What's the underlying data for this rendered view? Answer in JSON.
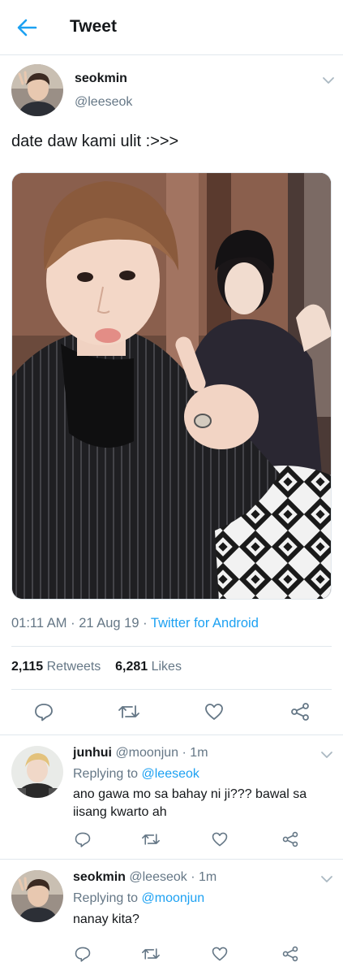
{
  "header": {
    "title": "Tweet"
  },
  "tweet": {
    "name": "seokmin",
    "handle": "@leeseok",
    "text": "date daw kami ulit :>>>",
    "time": "01:11 AM",
    "date": "21 Aug 19",
    "source": "Twitter for Android",
    "retweets_count": "2,115",
    "retweets_label": "Retweets",
    "likes_count": "6,281",
    "likes_label": "Likes"
  },
  "replies": [
    {
      "name": "junhui",
      "handle": "@moonjun",
      "time": "1m",
      "replying_label": "Replying to",
      "replying_to": "@leeseok",
      "text": "ano gawa mo sa bahay ni ji??? bawal sa iisang kwarto ah"
    },
    {
      "name": "seokmin",
      "handle": "@leeseok",
      "time": "1m",
      "replying_label": "Replying to",
      "replying_to": "@moonjun",
      "text": "nanay kita?"
    }
  ],
  "separator": "·",
  "colors": {
    "accent": "#1da1f2",
    "muted": "#657786",
    "text": "#14171a",
    "border": "#e1e8ed"
  },
  "icons": [
    "back-arrow-icon",
    "chevron-down-icon",
    "reply-icon",
    "retweet-icon",
    "like-icon",
    "share-icon"
  ]
}
